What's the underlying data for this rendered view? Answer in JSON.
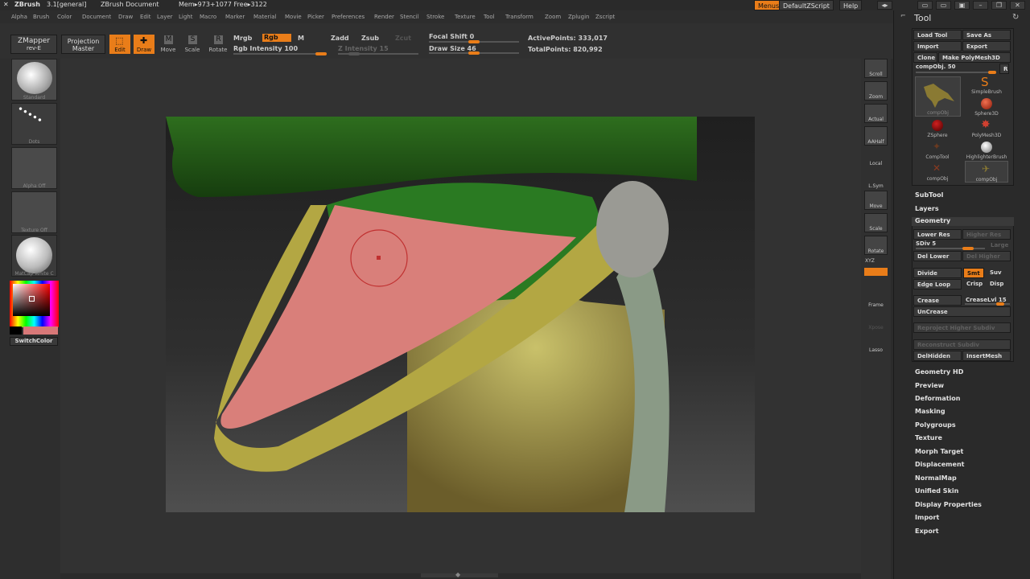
{
  "titlebar": {
    "app": "ZBrush",
    "version": "3.1[general]",
    "document": "ZBrush Document",
    "mem": "Mem▸973+1077 Free▸3122",
    "menus": "Menus",
    "script": "DefaultZScript",
    "help": "Help"
  },
  "menu": [
    "Alpha",
    "Brush",
    "Color",
    "Document",
    "Draw",
    "Edit",
    "Layer",
    "Light",
    "Macro",
    "Marker",
    "Material",
    "Movie",
    "Picker",
    "Preferences",
    "Render",
    "Stencil",
    "Stroke",
    "Texture",
    "Tool",
    "Transform",
    "Zoom",
    "Zplugin",
    "Zscript"
  ],
  "toolbar": {
    "zmapper": "ZMapper",
    "zmapper2": "rev-E",
    "projection": "Projection",
    "projection2": "Master",
    "edit": "Edit",
    "draw": "Draw",
    "move": "Move",
    "scale": "Scale",
    "rotate": "Rotate",
    "mrgb": "Mrgb",
    "rgb": "Rgb",
    "m": "M",
    "rgb_intensity": "Rgb Intensity 100",
    "zadd": "Zadd",
    "zsub": "Zsub",
    "zcut": "Zcut",
    "z_intensity": "Z Intensity 15",
    "focal_shift": "Focal Shift 0",
    "draw_size": "Draw Size 46",
    "active_points": "ActivePoints: 333,017",
    "total_points": "TotalPoints: 820,992",
    "rgb_intensity_level": 1.0,
    "z_intensity_level": 0.15,
    "focal_shift_level": 0.5,
    "draw_size_level": 0.36
  },
  "left": {
    "standard": "Standard",
    "dots": "Dots",
    "alpha": "Alpha Off",
    "texture": "Texture Off",
    "matcap": "MatCap White C",
    "switch_color": "SwitchColor"
  },
  "right": [
    "Scroll",
    "Zoom",
    "Actual",
    "AAHalf",
    "Local",
    "L.Sym",
    "Move",
    "Scale",
    "Rotate",
    "XYZ",
    "Frame",
    "Xpose",
    "Lasso"
  ],
  "panel": {
    "title": "Tool",
    "load": "Load Tool",
    "save": "Save As",
    "import": "Import",
    "export": "Export",
    "clone": "Clone",
    "polymesh": "Make PolyMesh3D",
    "comp": "compObj. 50",
    "r": "R",
    "tools": [
      "compObj",
      "SimpleBrush",
      "Sphere3D",
      "ZSphere",
      "PolyMesh3D",
      "CompTool",
      "HighlighterBrush",
      "compObj",
      "compObj"
    ],
    "subtool": "SubTool",
    "layers": "Layers",
    "geometry": "Geometry",
    "lower_res": "Lower Res",
    "higher_res": "Higher Res",
    "sdiv": "SDiv 5",
    "sdiv_level": 0.8,
    "large": "Large",
    "del_lower": "Del Lower",
    "del_higher": "Del Higher",
    "divide": "Divide",
    "smt": "Smt",
    "suv": "Suv",
    "edge_loop": "Edge Loop",
    "crisp": "Crisp",
    "disp": "Disp",
    "crease": "Crease",
    "crease_lvl": "CreaseLvl 15",
    "crease_level": 0.15,
    "uncrease": "UnCrease",
    "reproject": "Reproject Higher Subdiv",
    "reconstruct": "Reconstruct Subdiv",
    "delhidden": "DelHidden",
    "insertmesh": "InsertMesh",
    "sections": [
      "Geometry HD",
      "Preview",
      "Deformation",
      "Masking",
      "Polygroups",
      "Texture",
      "Morph Target",
      "Displacement",
      "NormalMap",
      "Unified Skin",
      "Display Properties",
      "Import",
      "Export"
    ]
  },
  "colors": {
    "accent": "#e97d19",
    "secondary": "#d87878"
  }
}
